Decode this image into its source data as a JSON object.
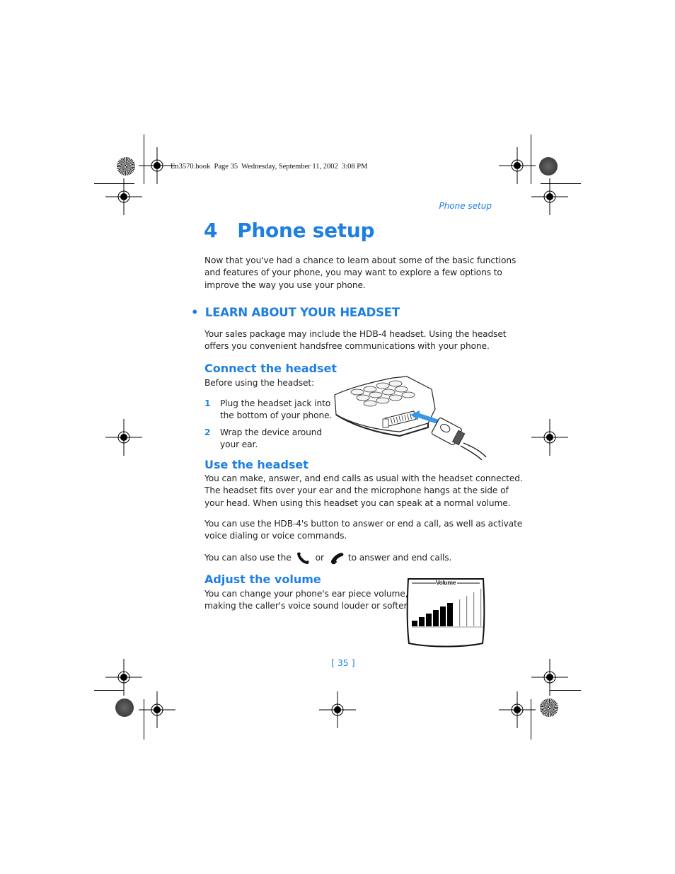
{
  "print_slug": "En3570.book  Page 35  Wednesday, September 11, 2002  3:08 PM",
  "running_header": "Phone setup",
  "chapter": {
    "number": "4",
    "title": "Phone setup",
    "intro": [
      "Now that you've had a chance to learn about some of the basic functions",
      "and features of your phone, you may want to explore a few options to",
      "improve the way you use your phone."
    ]
  },
  "section": {
    "bullet": "•",
    "title": "LEARN ABOUT YOUR HEADSET",
    "intro": [
      "Your sales package may include the HDB-4 headset. Using the headset",
      "offers you convenient handsfree communications with your phone."
    ]
  },
  "connect": {
    "heading": "Connect the headset",
    "lead": "Before using the headset:",
    "steps": [
      {
        "num": "1",
        "lines": [
          "Plug the headset jack into",
          "the bottom of your phone."
        ]
      },
      {
        "num": "2",
        "lines": [
          "Wrap the device around",
          "your ear."
        ]
      }
    ],
    "illustration": "phone-headset-connector-illustration"
  },
  "use": {
    "heading": "Use the headset",
    "para1": [
      "You can make, answer, and end calls as usual with the headset connected.",
      "The headset fits over your ear and the microphone hangs at the side of",
      "your head. When using this headset you can speak at a normal volume."
    ],
    "para2": [
      "You can use the HDB-4's button to answer or end a call, as well as activate",
      "voice dialing or voice commands."
    ],
    "para3_before": "You can also use the",
    "para3_or": "or",
    "para3_after": "to answer and end calls.",
    "icons": [
      "call-key-icon",
      "end-key-icon"
    ]
  },
  "volume": {
    "heading": "Adjust the volume",
    "para": [
      "You can change your phone's ear piece volume,",
      "making the caller's voice sound louder or softer."
    ],
    "display_title": "Volume",
    "level": 6,
    "max_level": 10
  },
  "page_number": "[ 35 ]",
  "colors": {
    "accent": "#1e7fe0",
    "text": "#222222"
  }
}
